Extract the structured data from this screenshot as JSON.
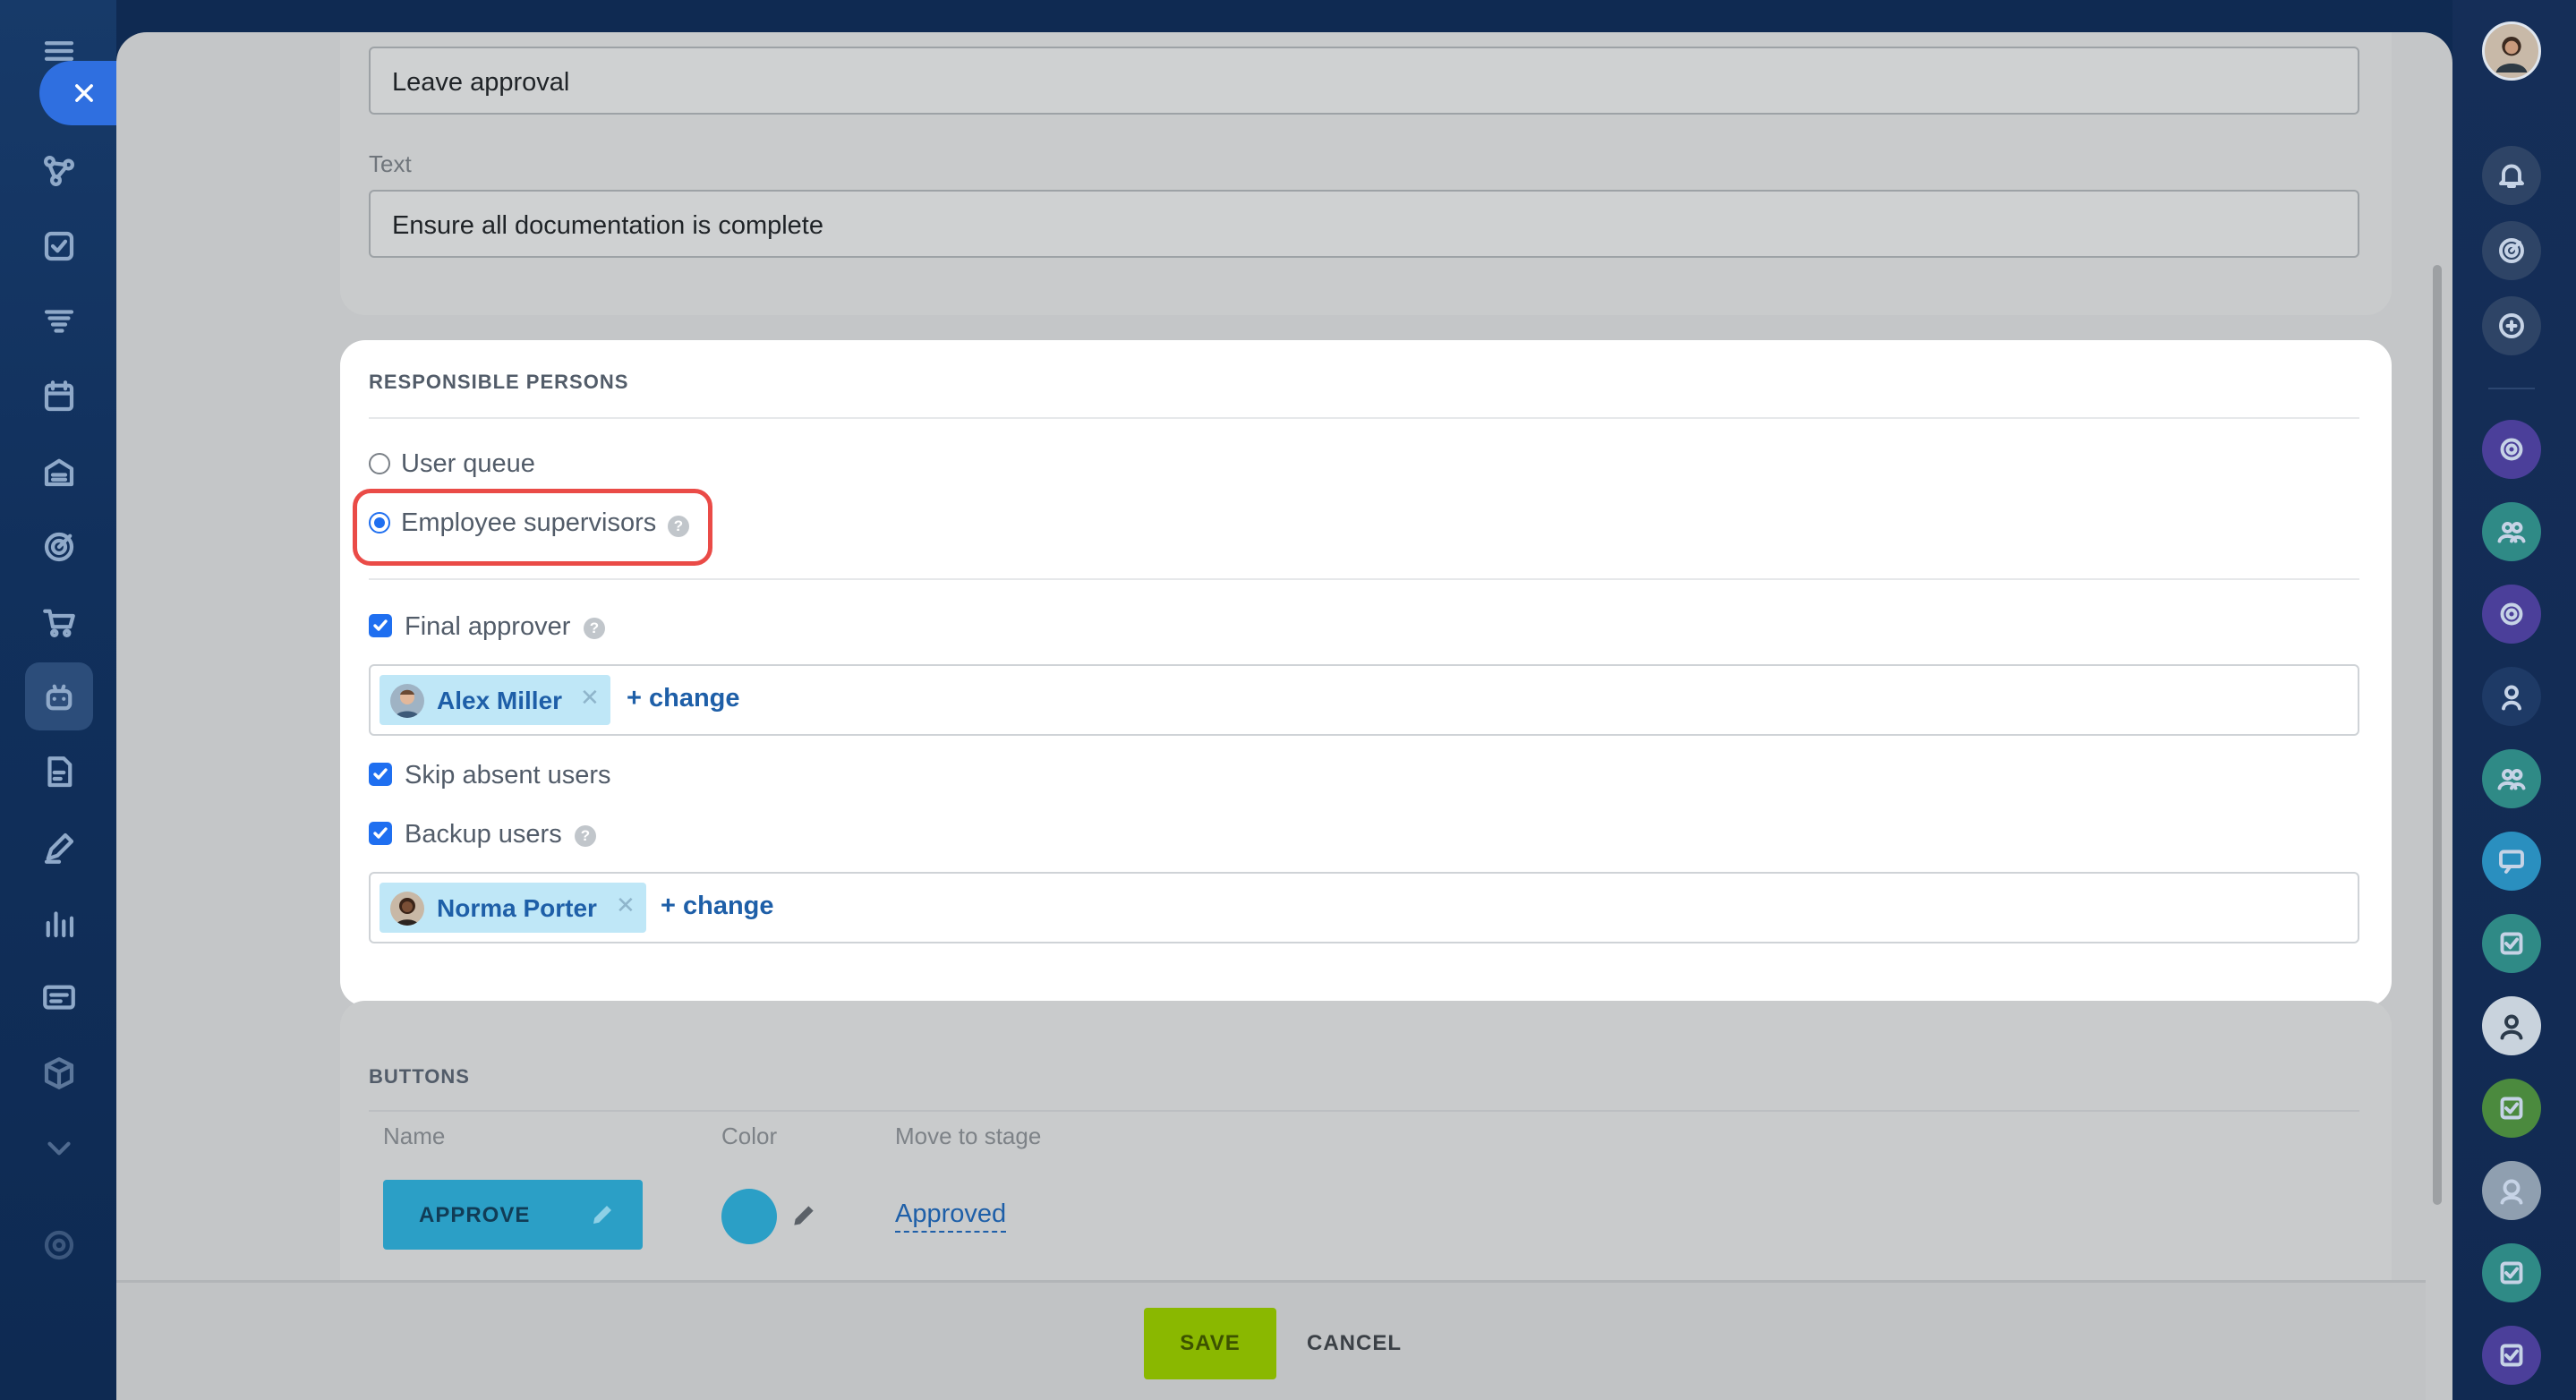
{
  "form": {
    "title_value": "Leave approval",
    "text_label": "Text",
    "text_value": "Ensure all documentation is complete"
  },
  "responsible": {
    "section_title": "RESPONSIBLE PERSONS",
    "option_user_queue": "User queue",
    "option_employee_supervisors": "Employee supervisors",
    "selected_option": "Employee supervisors",
    "final_approver_label": "Final approver",
    "final_approver_checked": true,
    "final_approver_user": "Alex Miller",
    "skip_absent_label": "Skip absent users",
    "skip_absent_checked": true,
    "backup_users_label": "Backup users",
    "backup_users_checked": true,
    "backup_user": "Norma Porter",
    "change_link": "+ change",
    "help_glyph": "?"
  },
  "buttons_section": {
    "section_title": "BUTTONS",
    "col_name": "Name",
    "col_color": "Color",
    "col_stage": "Move to stage",
    "rows": [
      {
        "name": "APPROVE",
        "color": "#2b9fc6",
        "stage": "Approved"
      }
    ]
  },
  "footer": {
    "save_label": "SAVE",
    "cancel_label": "CANCEL"
  },
  "colors": {
    "accent_blue": "#1f6ff0",
    "save_green": "#8ab800",
    "highlight_red": "#ea4b47"
  },
  "icons": {
    "left_sidebar": [
      "menu-icon",
      "close-icon",
      "flow-icon",
      "task-icon",
      "filter-icon",
      "calendar-icon",
      "storage-icon",
      "target-icon",
      "cart-icon",
      "robot-icon",
      "document-edit-icon",
      "pen-icon",
      "chart-icon",
      "message-icon",
      "box-icon",
      "chevron-down-icon",
      "settings-icon"
    ],
    "right_sidebar": [
      "user-avatar",
      "bell-icon",
      "target-icon",
      "search-chat-icon",
      "chat-avatars"
    ]
  }
}
